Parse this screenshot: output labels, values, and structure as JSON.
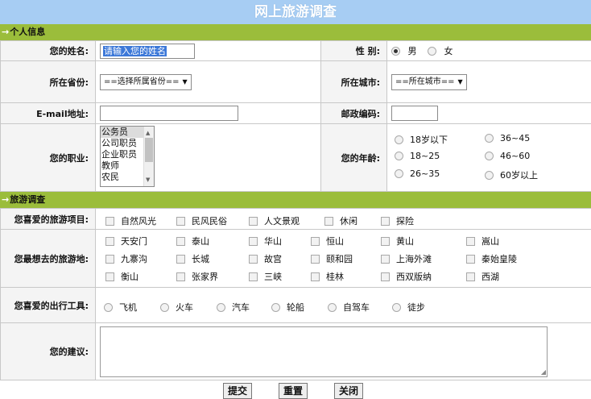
{
  "page": {
    "title": "网上旅游调查"
  },
  "section_personal": {
    "label": "个人信息"
  },
  "personal": {
    "name_label": "您的姓名:",
    "name_value": "请输入您的姓名",
    "gender_label": "性 别:",
    "gender_options": [
      {
        "label": "男",
        "checked": true
      },
      {
        "label": "女",
        "checked": false
      }
    ],
    "province_label": "所在省份:",
    "province_value": "==选择所属省份==",
    "city_label": "所在城市:",
    "city_value": "==所在城市==",
    "email_label": "E-mail地址:",
    "zip_label": "邮政编码:",
    "job_label": "您的职业:",
    "job_options": [
      "公务员",
      "公司职员",
      "企业职员",
      "教师",
      "农民"
    ],
    "job_selected": "公务员",
    "age_label": "您的年龄:",
    "age_options": [
      "18岁以下",
      "36~45",
      "18~25",
      "46~60",
      "26~35",
      "60岁以上"
    ]
  },
  "section_travel": {
    "label": "旅游调查"
  },
  "travel": {
    "project_label": "您喜爱的旅游项目:",
    "project_options": [
      "自然风光",
      "民风民俗",
      "人文景观",
      "休闲",
      "探险"
    ],
    "dest_label": "您最想去的旅游地:",
    "dest_options": [
      [
        "天安门",
        "泰山",
        "华山",
        "恒山",
        "黄山",
        "嵩山"
      ],
      [
        "九寨沟",
        "长城",
        "故宫",
        "颐和园",
        "上海外滩",
        "秦始皇陵"
      ],
      [
        "衡山",
        "张家界",
        "三峡",
        "桂林",
        "西双版纳",
        "西湖"
      ]
    ],
    "transport_label": "您喜爱的出行工具:",
    "transport_options": [
      "飞机",
      "火车",
      "汽车",
      "轮船",
      "自驾车",
      "徒步"
    ],
    "suggest_label": "您的建议:"
  },
  "buttons": {
    "submit": "提交",
    "reset": "重置",
    "close": "关闭"
  }
}
